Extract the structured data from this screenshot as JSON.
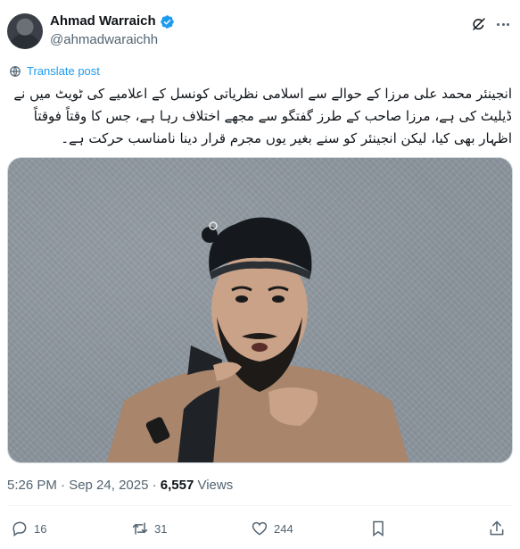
{
  "post": {
    "author": {
      "name": "Ahmad Warraich",
      "handle": "@ahmadwaraichh",
      "verified": true
    },
    "translate_label": "Translate post",
    "text": "انجینئر محمد علی مرزا کے حوالے سے اسلامی نظریاتی کونسل کے اعلامیے کی ٹویٹ میں نے ڈیلیٹ کی ہے، مرزا صاحب کے طرز گفتگو سے مجھے اختلاف رہا ہے، جس کا وقتاً فوقتاً اظہار بھی کیا، لیکن انجینئر کو سنے بغیر یوں مجرم قرار دینا نامناسب حرکت ہے۔",
    "timestamp": "5:26 PM · Sep 24, 2025 · ",
    "views_count": "6,557",
    "views_label": " Views"
  },
  "actions": {
    "replies": "16",
    "reposts": "31",
    "likes": "244"
  },
  "icons": {
    "verified": "verified-badge-icon",
    "grok": "grok-icon",
    "more": "more-icon",
    "translate": "globe-icon",
    "reply": "reply-icon",
    "repost": "repost-icon",
    "like": "heart-icon",
    "bookmark": "bookmark-icon",
    "share": "share-icon"
  },
  "colors": {
    "accent": "#1d9bf0",
    "text": "#0f1419",
    "secondary": "#536471"
  }
}
